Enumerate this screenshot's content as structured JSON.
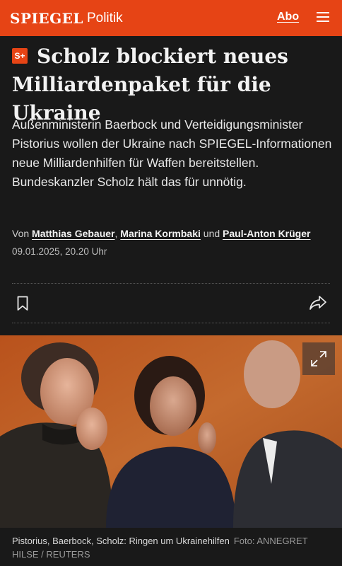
{
  "header": {
    "brand": "SPIEGEL",
    "section": "Politik",
    "abo_label": "Abo",
    "menu_icon": "hamburger-menu-icon",
    "background_color": "#e64415"
  },
  "article": {
    "badge": "S+",
    "headline": "Scholz blockiert neues Milliardenpaket für die Ukraine",
    "teaser": "Außenministerin Baerbock und Verteidigungsminister Pistorius wollen der Ukraine nach SPIEGEL-Informationen neue Milliardenhilfen für Waffen bereitstellen. Bundeskanzler Scholz hält das für unnötig.",
    "byline": {
      "prefix": "Von",
      "authors": [
        "Matthias Gebauer",
        "Marina Kormbaki",
        "Paul-Anton Krüger"
      ],
      "separator": ",",
      "conjunction": "und"
    },
    "date": "09.01.2025, 20.20 Uhr",
    "actions": {
      "bookmark_icon": "bookmark-icon",
      "share_icon": "share-icon"
    }
  },
  "image": {
    "expand_icon": "expand-icon",
    "caption": "Pistorius, Baerbock, Scholz: Ringen um Ukrainehilfen",
    "credit": "Foto: ANNEGRET HILSE / REUTERS"
  }
}
